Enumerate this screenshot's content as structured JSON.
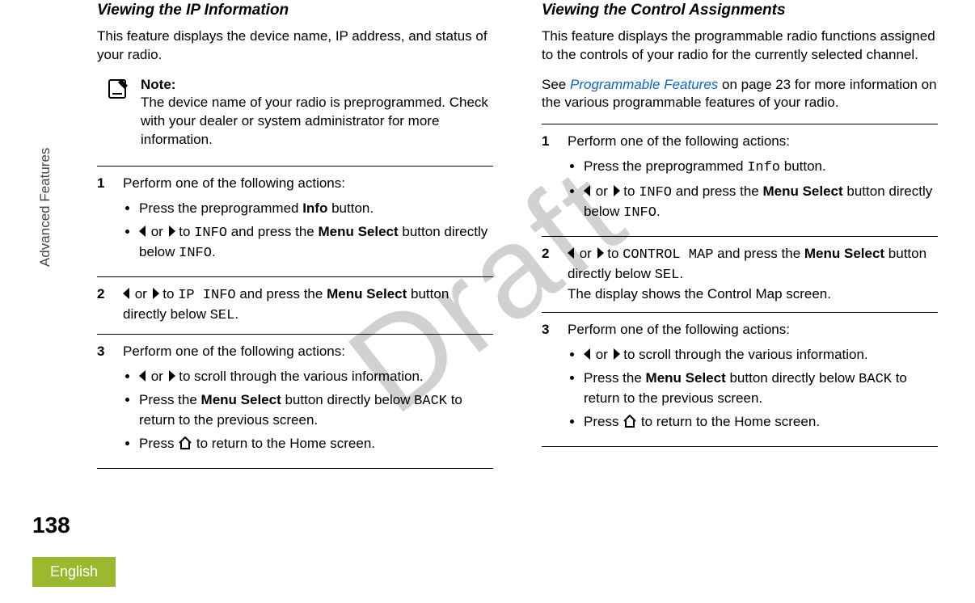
{
  "side_label": "Advanced Features",
  "page_number": "138",
  "language": "English",
  "watermark": "Draft",
  "left": {
    "heading": "Viewing the IP Information",
    "intro": "This feature displays the device name, IP address, and status of your radio.",
    "note_label": "Note:",
    "note_body": "The device name of your radio is preprogrammed. Check with your dealer or system administrator for more information.",
    "steps": {
      "s1": {
        "num": "1",
        "text": "Perform one of the following actions:",
        "b1_pre": "Press the preprogrammed ",
        "b1_bold": "Info",
        "b1_post": " button.",
        "b2_or": " or ",
        "b2_to": " to ",
        "b2_mono1": "INFO",
        "b2_mid": " and press the ",
        "b2_bold": "Menu Select",
        "b2_post1": " button directly below ",
        "b2_mono2": "INFO",
        "b2_end": "."
      },
      "s2": {
        "num": "2",
        "or": " or ",
        "to": " to ",
        "mono1": "IP INFO",
        "mid": " and press the ",
        "bold": "Menu Select",
        "post1": " button directly below ",
        "mono2": "SEL",
        "end": "."
      },
      "s3": {
        "num": "3",
        "text": "Perform one of the following actions:",
        "b1_or": " or ",
        "b1_post": " to scroll through the various information.",
        "b2_pre": "Press the ",
        "b2_bold": "Menu Select",
        "b2_mid": " button directly below ",
        "b2_mono": "BACK",
        "b2_post": " to return to the previous screen.",
        "b3_pre": "Press ",
        "b3_post": " to return to the Home screen."
      }
    }
  },
  "right": {
    "heading": "Viewing the Control Assignments",
    "intro": "This feature displays the programmable radio functions assigned to the controls of your radio for the currently selected channel.",
    "see_pre": "See ",
    "see_link": "Programmable Features",
    "see_post": " on page 23 for more information on the various programmable features of your radio.",
    "steps": {
      "s1": {
        "num": "1",
        "text": "Perform one of the following actions:",
        "b1_pre": "Press the preprogrammed ",
        "b1_mono": "Info",
        "b1_post": " button.",
        "b2_or": " or ",
        "b2_to": " to ",
        "b2_mono1": "INFO",
        "b2_mid": " and press the ",
        "b2_bold": "Menu Select",
        "b2_post1": " button directly below ",
        "b2_mono2": "INFO",
        "b2_end": "."
      },
      "s2": {
        "num": "2",
        "or": " or ",
        "to": " to ",
        "mono1": "CONTROL MAP",
        "mid": " and press the ",
        "bold": "Menu Select",
        "post1": " button directly below ",
        "mono2": "SEL",
        "end": ".",
        "line2": "The display shows the Control Map screen."
      },
      "s3": {
        "num": "3",
        "text": "Perform one of the following actions:",
        "b1_or": " or ",
        "b1_post": " to scroll through the various information.",
        "b2_pre": "Press the ",
        "b2_bold": "Menu Select",
        "b2_mid": " button directly below ",
        "b2_mono": "BACK",
        "b2_post": " to return to the previous screen.",
        "b3_pre": "Press ",
        "b3_post": " to return to the Home screen."
      }
    }
  }
}
